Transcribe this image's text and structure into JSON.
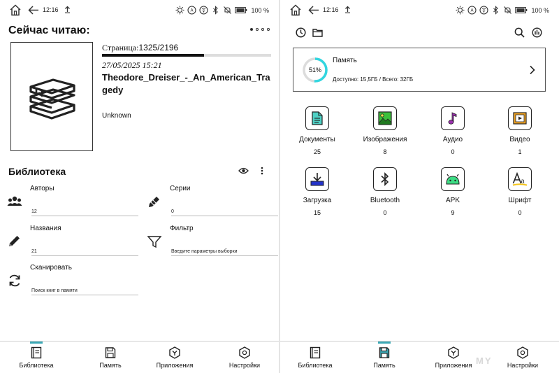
{
  "status_bar": {
    "time": "12:16",
    "battery": "100 %"
  },
  "reading": {
    "title": "Сейчас читаю:",
    "page_label": "Страница:",
    "page_value": "1325/2196",
    "progress": 0.603,
    "date": "27/05/2025 15:21",
    "book_title": "Theodore_Dreiser_-_An_American_Tragedy",
    "author": "Unknown"
  },
  "library": {
    "title": "Библиотека",
    "items": [
      {
        "label": "Авторы",
        "value": "12",
        "icon": "authors-icon"
      },
      {
        "label": "Серии",
        "value": "0",
        "icon": "series-pen-icon"
      },
      {
        "label": "Названия",
        "value": "21",
        "icon": "titles-pencil-icon"
      },
      {
        "label": "Фильтр",
        "value": "Введите параметры выборки",
        "icon": "filter-icon"
      },
      {
        "label": "Сканировать",
        "value": "Поиск книг в памяти",
        "icon": "refresh-icon"
      }
    ]
  },
  "memory": {
    "title": "Память",
    "percent": "51%",
    "percent_value": 51,
    "info": "Доступно: 15,5ГБ / Всего: 32ГБ"
  },
  "categories": [
    {
      "label": "Документы",
      "count": "25",
      "icon": "document-icon"
    },
    {
      "label": "Изображения",
      "count": "8",
      "icon": "image-icon"
    },
    {
      "label": "Аудио",
      "count": "0",
      "icon": "music-note-icon"
    },
    {
      "label": "Видео",
      "count": "1",
      "icon": "video-icon"
    },
    {
      "label": "Загрузка",
      "count": "15",
      "icon": "download-icon"
    },
    {
      "label": "Bluetooth",
      "count": "0",
      "icon": "bluetooth-icon"
    },
    {
      "label": "APK",
      "count": "9",
      "icon": "android-icon"
    },
    {
      "label": "Шрифт",
      "count": "0",
      "icon": "font-icon"
    }
  ],
  "nav": {
    "items": [
      "Библиотека",
      "Память",
      "Приложения",
      "Настройки"
    ]
  },
  "colors": {
    "accent": "#3ba9b6",
    "ring": "#32d6e0",
    "doc": "#4fd1c5",
    "image_green": "#3cc03c",
    "audio": "#9b2fae",
    "video": "#f5a623",
    "download": "#2433c9",
    "android": "#3ddc84"
  },
  "watermark": "MY"
}
